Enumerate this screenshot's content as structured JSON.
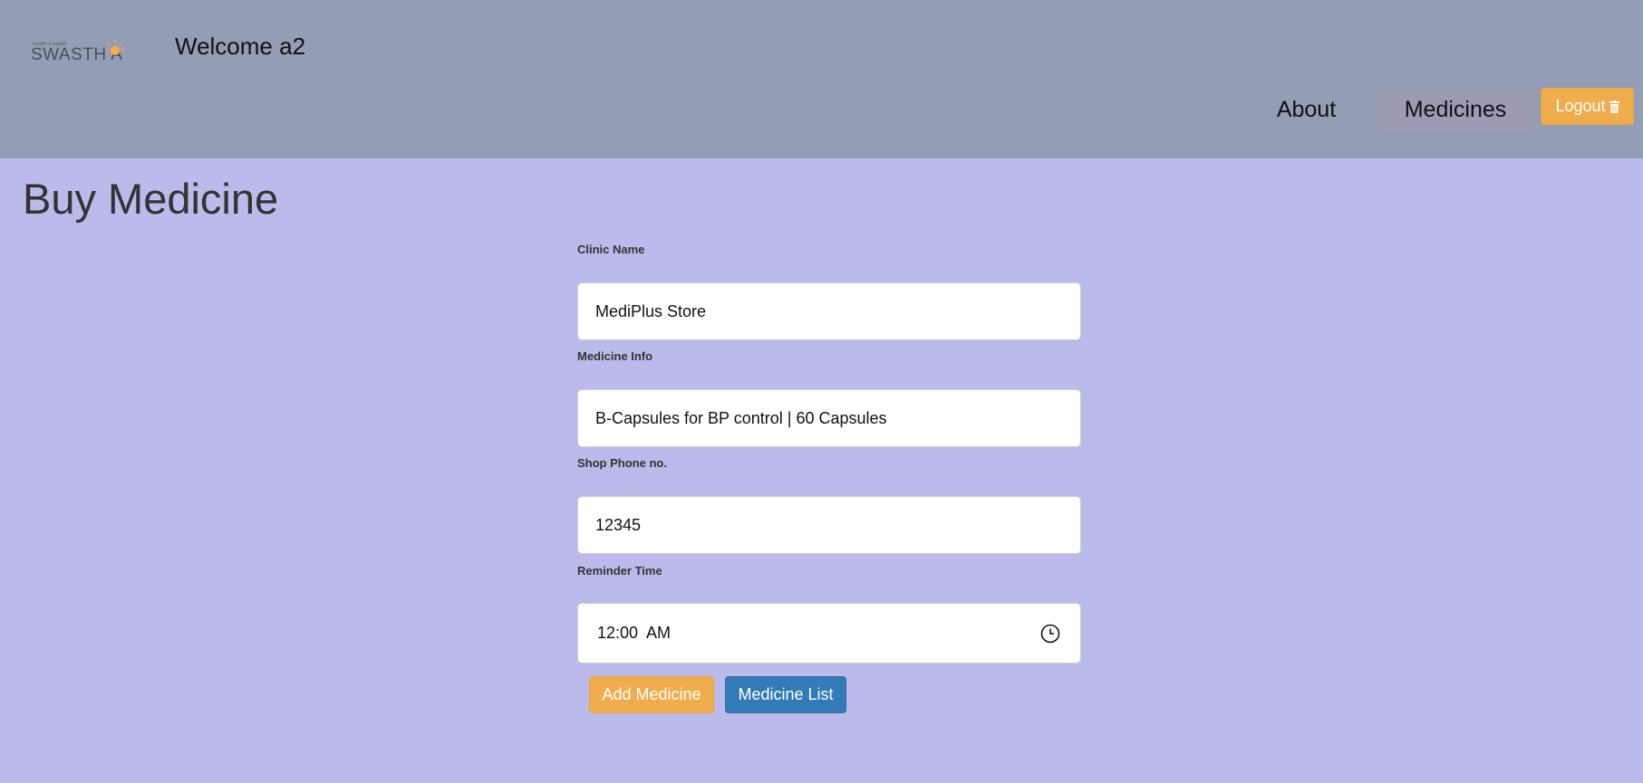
{
  "header": {
    "logo_text": "SWASTH A",
    "logo_tagline": "health is wealth",
    "welcome": "Welcome a2",
    "nav": {
      "about": "About",
      "medicines": "Medicines"
    },
    "logout_label": "Logout"
  },
  "page": {
    "title": "Buy Medicine"
  },
  "form": {
    "clinic_name_label": "Clinic Name",
    "clinic_name_value": "MediPlus Store",
    "medicine_info_label": "Medicine Info",
    "medicine_info_value": "B-Capsules for BP control | 60 Capsules",
    "shop_phone_label": "Shop Phone no.",
    "shop_phone_value": "12345",
    "reminder_time_label": "Reminder Time",
    "reminder_time_value": "12:00  AM",
    "add_button": "Add Medicine",
    "list_button": "Medicine List"
  },
  "colors": {
    "header_bg": "#939db6",
    "page_bg": "#babbea",
    "warning": "#f0ad4e",
    "primary": "#337ab7",
    "active_nav_bg": "#9c9bb3"
  },
  "icons": {
    "logout": "trash-icon",
    "time": "clock-icon",
    "logo": "sun-icon"
  }
}
